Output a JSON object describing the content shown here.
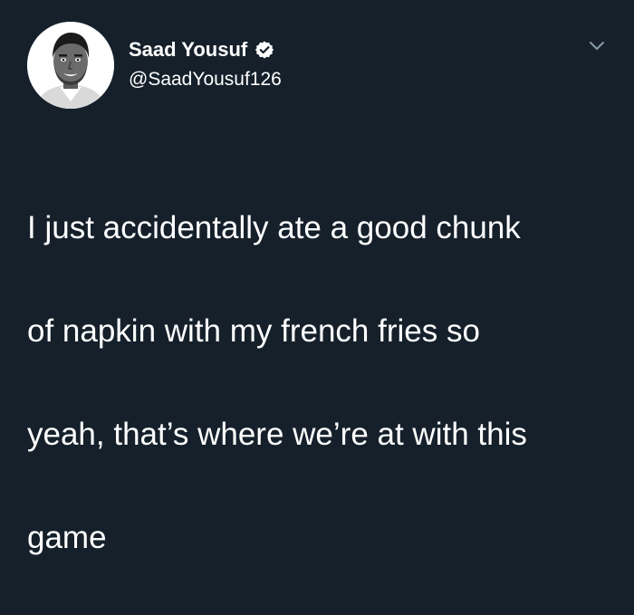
{
  "tweet": {
    "author": {
      "display_name": "Saad Yousuf",
      "handle": "@SaadYousuf126",
      "verified": true,
      "avatar_icon": "profile-avatar-illustration"
    },
    "menu_icon": "chevron-down-icon",
    "text_lines": [
      "I just accidentally ate a good chunk",
      "of napkin with my french fries so",
      "yeah, that’s where we’re at with this",
      "game"
    ]
  },
  "colors": {
    "background": "#15202b",
    "text": "#ffffff",
    "chevron": "#8899a6"
  }
}
